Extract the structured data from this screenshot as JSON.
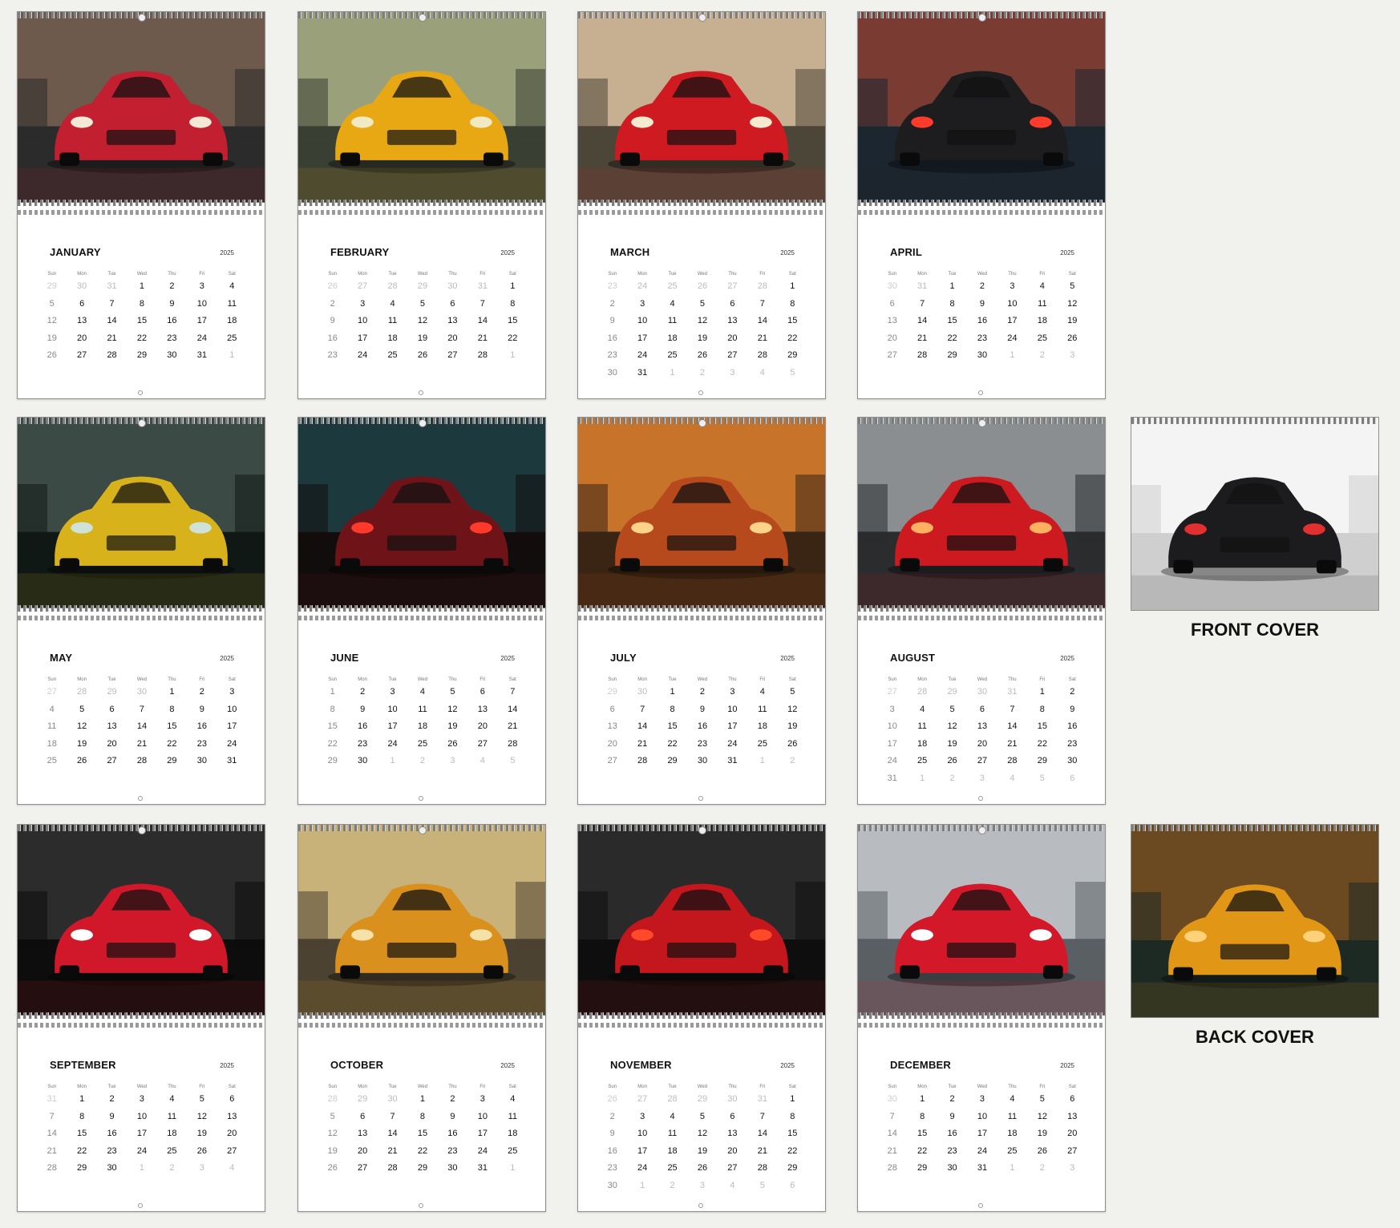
{
  "year": "2025",
  "weekday_labels": [
    "Sun",
    "Mon",
    "Tue",
    "Wed",
    "Thu",
    "Fri",
    "Sat"
  ],
  "months": [
    {
      "name": "JANUARY",
      "start": 3,
      "days": 31,
      "prev_days": 31
    },
    {
      "name": "FEBRUARY",
      "start": 6,
      "days": 28,
      "prev_days": 31
    },
    {
      "name": "MARCH",
      "start": 6,
      "days": 31,
      "prev_days": 28
    },
    {
      "name": "APRIL",
      "start": 2,
      "days": 30,
      "prev_days": 31
    },
    {
      "name": "MAY",
      "start": 4,
      "days": 31,
      "prev_days": 30
    },
    {
      "name": "JUNE",
      "start": 0,
      "days": 30,
      "prev_days": 31
    },
    {
      "name": "JULY",
      "start": 2,
      "days": 31,
      "prev_days": 30
    },
    {
      "name": "AUGUST",
      "start": 5,
      "days": 31,
      "prev_days": 31
    },
    {
      "name": "SEPTEMBER",
      "start": 1,
      "days": 30,
      "prev_days": 31
    },
    {
      "name": "OCTOBER",
      "start": 3,
      "days": 31,
      "prev_days": 30
    },
    {
      "name": "NOVEMBER",
      "start": 6,
      "days": 30,
      "prev_days": 31
    },
    {
      "name": "DECEMBER",
      "start": 1,
      "days": 31,
      "prev_days": 30
    }
  ],
  "photos": [
    {
      "icon": "red-sports-car-front-photo",
      "car": "#c21f30",
      "bg1": "#6e5a4d",
      "bg2": "#2b2b2b",
      "light": "#f2e8d5"
    },
    {
      "icon": "yellow-sports-car-rear-photo",
      "car": "#e8a814",
      "bg1": "#9aa07a",
      "bg2": "#3a3f33",
      "light": "#f1e9c4"
    },
    {
      "icon": "red-sports-car-side-photo",
      "car": "#d01a22",
      "bg1": "#c6b091",
      "bg2": "#4c4638",
      "light": "#f5ead0"
    },
    {
      "icon": "black-sports-car-rear-forest-photo",
      "car": "#1d1d1f",
      "bg1": "#7a3b33",
      "bg2": "#1c2630",
      "light": "#ff3b2c"
    },
    {
      "icon": "yellow-classic-car-garage-photo",
      "car": "#d7b21b",
      "bg1": "#3c4a46",
      "bg2": "#101816",
      "light": "#cfe2d8"
    },
    {
      "icon": "red-car-rear-neon-photo",
      "car": "#6e1418",
      "bg1": "#1c3a3e",
      "bg2": "#120d0d",
      "light": "#ff3a2a"
    },
    {
      "icon": "orange-classic-car-autumn-photo",
      "car": "#b74a1c",
      "bg1": "#c7732a",
      "bg2": "#3a2514",
      "light": "#ffd28a"
    },
    {
      "icon": "red-car-closeup-photo",
      "car": "#cc1a20",
      "bg1": "#8a8e90",
      "bg2": "#2a2c2e",
      "light": "#ffb060"
    },
    {
      "icon": "red-sports-car-rain-photo",
      "car": "#d1182a",
      "bg1": "#2c2c2c",
      "bg2": "#0d0d0d",
      "light": "#ffffff"
    },
    {
      "icon": "orange-supercar-coast-photo",
      "car": "#d9901c",
      "bg1": "#c9b27a",
      "bg2": "#4c4232",
      "light": "#f6e2a8"
    },
    {
      "icon": "red-supercar-rear-dark-photo",
      "car": "#c3161d",
      "bg1": "#2a2a2a",
      "bg2": "#0e0e0e",
      "light": "#ff4a2a"
    },
    {
      "icon": "red-hypercar-front-photo",
      "car": "#d3182a",
      "bg1": "#b8bcc0",
      "bg2": "#5a5f64",
      "light": "#ffffff"
    }
  ],
  "covers": [
    {
      "label": "FRONT COVER",
      "icon": "black-hypercar-front-cover-photo",
      "car": "#1c1c1e",
      "bg1": "#f4f4f4",
      "bg2": "#cfcfcf",
      "light": "#e23030"
    },
    {
      "label": "BACK COVER",
      "icon": "orange-supercar-city-lights-back-cover-photo",
      "car": "#e29615",
      "bg1": "#6b4a22",
      "bg2": "#1d2a24",
      "light": "#ffd27a"
    }
  ]
}
